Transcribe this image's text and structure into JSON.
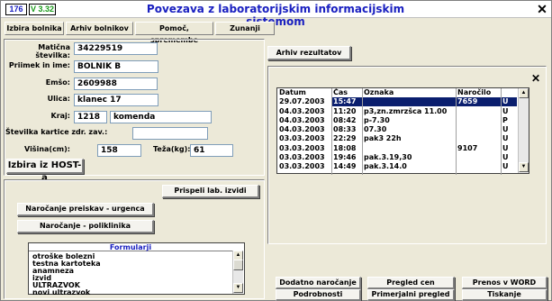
{
  "title": {
    "id_badge": "176",
    "version": "V 3.32",
    "text": "Povezava z laboratorijskim informacijskim sistemom",
    "close": "✕"
  },
  "menu": [
    {
      "label": "Izbira bolnika"
    },
    {
      "label": "Arhiv bolnikov"
    },
    {
      "label": "Pomoč, spremembe"
    },
    {
      "label": "Zunanji"
    }
  ],
  "patient": {
    "maticna_label": "Matična številka:",
    "maticna_value": "34229519",
    "name_label": "Priimek in ime:",
    "name_value": "BOLNIK B",
    "emso_label": "Emšo:",
    "emso_value": "2609988",
    "street_label": "Ulica:",
    "street_value": "klanec 17",
    "city_label": "Kraj:",
    "postal_value": "1218",
    "city_value": "komenda",
    "card_label": "Številka kartice zdr. zav.:",
    "card_value": "",
    "height_label": "Višina(cm):",
    "height_value": "158",
    "weight_label": "Teža(kg):",
    "weight_value": "61",
    "host_button": "Izbira iz HOST-a"
  },
  "left_actions": {
    "received": "Prispeli lab. izvidi",
    "urgent": "Naročanje preiskav - urgenca",
    "polyclinic": "Naročanje - poliklinika"
  },
  "forms": {
    "title": "Formularji",
    "items": [
      "otroške bolezni",
      "testna kartoteka",
      "anamneza",
      "izvid",
      "ULTRAZVOK",
      "novi ultrazvok"
    ]
  },
  "archive": {
    "button": "Arhiv rezultatov",
    "close": "✕",
    "columns": [
      "Datum",
      "Čas",
      "Oznaka",
      "Naročilo",
      ""
    ],
    "rows": [
      [
        "29.07.2003",
        "15:47",
        "",
        "7659",
        "U"
      ],
      [
        "04.03.2003",
        "11:20",
        "p3,zn.zmrzšca 11.00",
        "",
        "U"
      ],
      [
        "04.03.2003",
        "08:42",
        "p-7.30",
        "",
        "P"
      ],
      [
        "04.03.2003",
        "08:33",
        "07.30",
        "",
        "U"
      ],
      [
        "03.03.2003",
        "22:29",
        "pak3 22h",
        "",
        "U"
      ],
      [
        "03.03.2003",
        "18:08",
        "",
        "9107",
        "U"
      ],
      [
        "03.03.2003",
        "19:46",
        "pak.3.19,30",
        "",
        "U"
      ],
      [
        "03.03.2003",
        "14:49",
        "pak.3.14.0",
        "",
        "U"
      ]
    ]
  },
  "bottom_buttons": {
    "extra_order": "Dodatno naročanje",
    "price_review": "Pregled cen",
    "word_export": "Prenos v WORD",
    "details": "Podrobnosti",
    "compare_review": "Primerjalni pregled",
    "print": "Tiskanje"
  }
}
